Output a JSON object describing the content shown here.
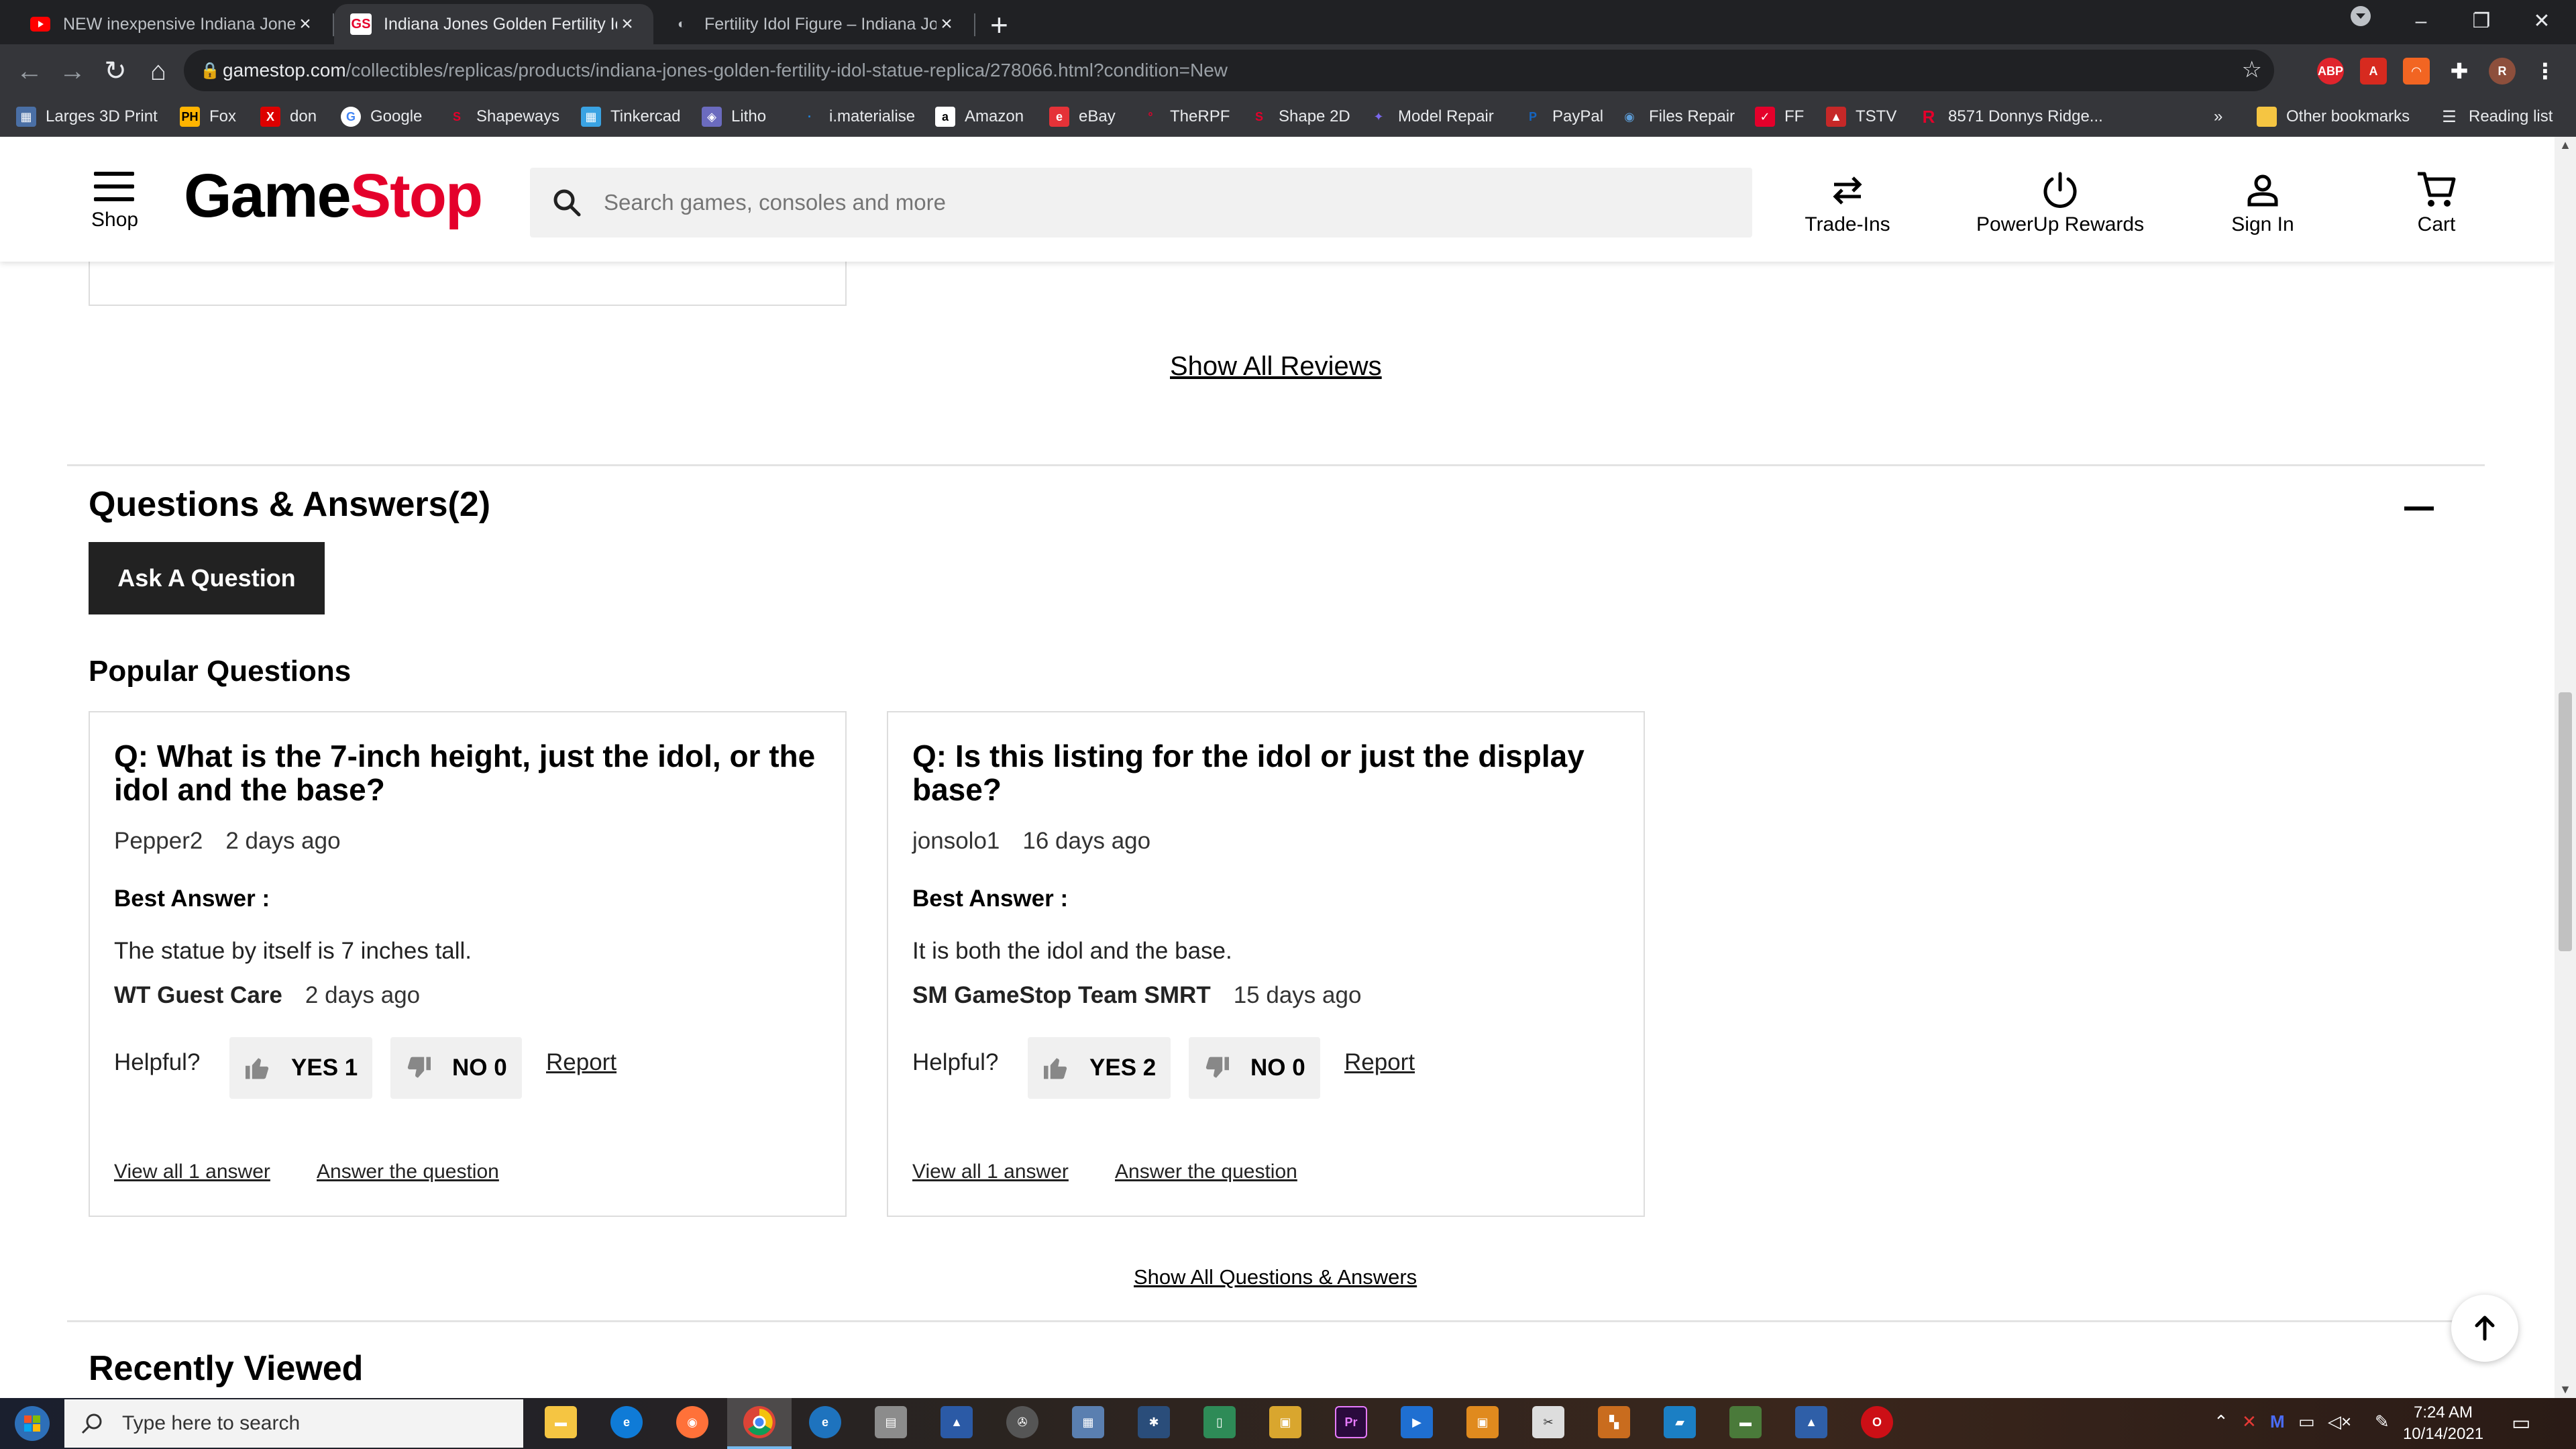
{
  "browser": {
    "tabs": [
      {
        "title": "NEW inexpensive Indiana Jones G",
        "active": false
      },
      {
        "title": "Indiana Jones Golden Fertility Ido",
        "active": true
      },
      {
        "title": "Fertility Idol Figure – Indiana Jon",
        "active": false
      }
    ],
    "url_host": "gamestop.com",
    "url_path": "/collectibles/replicas/products/indiana-jones-golden-fertility-idol-statue-replica/278066.html?condition=New",
    "profile_initial": "R",
    "extensions": {
      "abp": "ABP"
    },
    "bookmarks": [
      "Larges 3D Print",
      "Fox",
      "don",
      "Google",
      "Shapeways",
      "Tinkercad",
      "Litho",
      "i.materialise",
      "Amazon",
      "eBay",
      "TheRPF",
      "Shape 2D",
      "Model Repair",
      "PayPal",
      "Files Repair",
      "FF",
      "TSTV",
      "8571 Donnys Ridge..."
    ],
    "bookmarks_overflow": "»",
    "other_bookmarks": "Other bookmarks",
    "reading_list": "Reading list"
  },
  "site": {
    "logo_game": "Game",
    "logo_stop": "Stop",
    "shop_label": "Shop",
    "search_placeholder": "Search games, consoles and more",
    "trade_ins": "Trade-Ins",
    "powerup": "PowerUp Rewards",
    "sign_in": "Sign In",
    "cart": "Cart"
  },
  "reviews": {
    "show_all": "Show All Reviews"
  },
  "qa": {
    "title": "Questions & Answers(2)",
    "ask_button": "Ask A Question",
    "popular_title": "Popular Questions",
    "helpful_label": "Helpful?",
    "best_answer_label": "Best Answer :",
    "report_label": "Report",
    "answer_link": "Answer the question",
    "questions": [
      {
        "question": "Q: What is the 7-inch height, just the idol, or the idol and the base?",
        "asker": "Pepper2",
        "asked": "2 days ago",
        "answer": "The statue by itself is 7 inches tall.",
        "answerer": "WT Guest Care",
        "answered": "2 days ago",
        "yes": "YES 1",
        "no": "NO 0",
        "view_all": "View all 1 answer"
      },
      {
        "question": "Q: Is this listing for the idol or just the display base?",
        "asker": "jonsolo1",
        "asked": "16 days ago",
        "answer": "It is both the idol and the base.",
        "answerer": "SM GameStop Team SMRT",
        "answered": "15 days ago",
        "yes": "YES 2",
        "no": "NO 0",
        "view_all": "View all 1 answer"
      }
    ],
    "show_all": "Show All Questions & Answers"
  },
  "recently_viewed": "Recently Viewed",
  "taskbar": {
    "search_placeholder": "Type here to search",
    "time": "7:24 AM",
    "date": "10/14/2021",
    "premiere_label": "Pr"
  },
  "colors": {
    "brand_red": "#e4002b",
    "chrome_dark": "#202124",
    "chrome_toolbar": "#35363a",
    "ask_button_bg": "#222222"
  }
}
